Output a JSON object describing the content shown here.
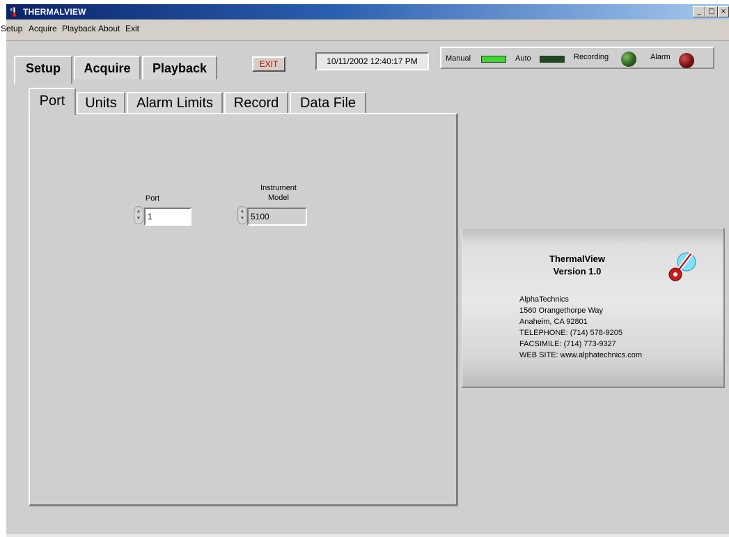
{
  "window": {
    "title": "THERMALVIEW"
  },
  "menu": [
    "Setup",
    "Acquire",
    "Playback",
    "About",
    "Exit"
  ],
  "main_tabs": [
    "Setup",
    "Acquire",
    "Playback"
  ],
  "exit_button": "EXIT",
  "datetime": "10/11/2002 12:40:17 PM",
  "status": {
    "manual": {
      "label": "Manual",
      "on": true,
      "color": "#3fd62f"
    },
    "auto": {
      "label": "Auto",
      "on": false,
      "color": "#1f4a1f"
    },
    "recording": {
      "label": "Recording",
      "color": "#2f5e1f"
    },
    "alarm": {
      "label": "Alarm",
      "color": "#7a1010"
    }
  },
  "sub_tabs": [
    "Port",
    "Units",
    "Alarm Limits",
    "Record",
    "Data File"
  ],
  "port": {
    "label": "Port",
    "value": "1"
  },
  "model": {
    "label_line1": "Instrument",
    "label_line2": "Model",
    "value": "5100"
  },
  "about": {
    "title": "ThermalView",
    "version": "Version 1.0",
    "lines": [
      "AlphaTechnics",
      "1560 Orangethorpe Way",
      "Anaheim, CA 92801",
      "TELEPHONE: (714) 578-9205",
      "FACSIMILE: (714) 773-9327",
      "WEB SITE: www.alphatechnics.com"
    ]
  }
}
